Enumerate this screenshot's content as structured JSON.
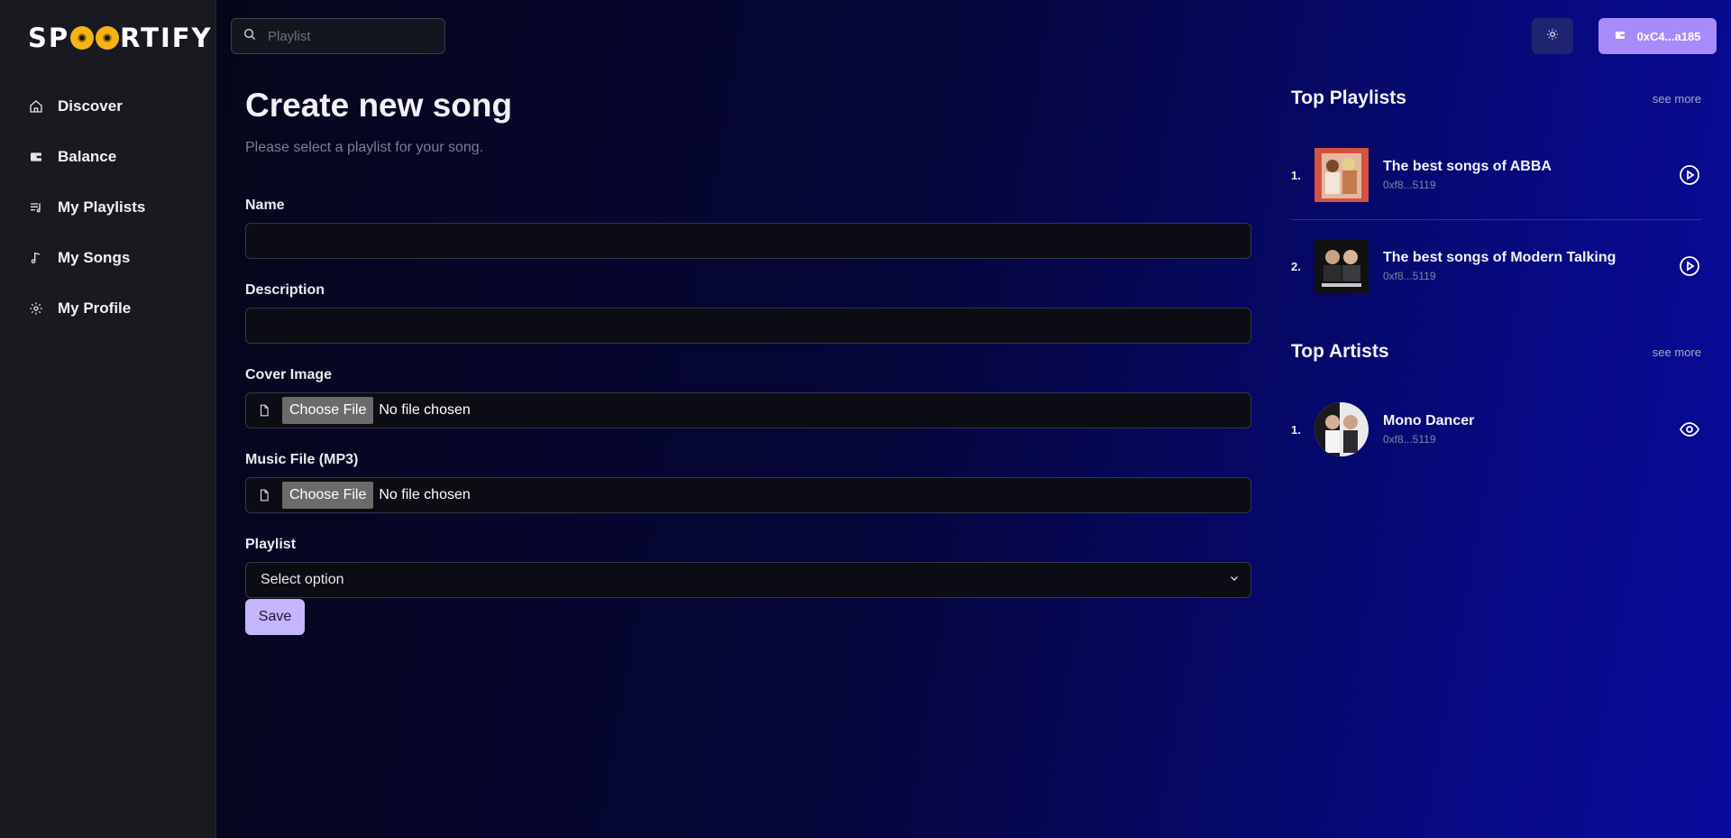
{
  "brand": {
    "name_part1": "SP",
    "name_part2": "RTIFY"
  },
  "sidebar": {
    "items": [
      {
        "label": "Discover",
        "icon": "home-icon"
      },
      {
        "label": "Balance",
        "icon": "wallet-icon"
      },
      {
        "label": "My Playlists",
        "icon": "playlist-icon"
      },
      {
        "label": "My Songs",
        "icon": "music-note-icon"
      },
      {
        "label": "My Profile",
        "icon": "gear-icon"
      }
    ]
  },
  "header": {
    "search_placeholder": "Playlist",
    "search_value": "",
    "wallet_label": "0xC4...a185"
  },
  "form": {
    "title": "Create new song",
    "subtitle": "Please select a playlist for your song.",
    "name_label": "Name",
    "name_value": "",
    "description_label": "Description",
    "description_value": "",
    "cover_label": "Cover Image",
    "music_label": "Music File (MP3)",
    "choose_file_label": "Choose File",
    "no_file_label": "No file chosen",
    "playlist_label": "Playlist",
    "playlist_selected": "Select option",
    "save_label": "Save"
  },
  "top_playlists": {
    "title": "Top Playlists",
    "see_more": "see more",
    "items": [
      {
        "rank": "1.",
        "name": "The best songs of ABBA",
        "address": "0xf8...5119"
      },
      {
        "rank": "2.",
        "name": "The best songs of Modern Talking",
        "address": "0xf8...5119"
      }
    ]
  },
  "top_artists": {
    "title": "Top Artists",
    "see_more": "see more",
    "items": [
      {
        "rank": "1.",
        "name": "Mono Dancer",
        "address": "0xf8...5119"
      }
    ]
  },
  "colors": {
    "accent": "#a78bfa",
    "save_button": "#c4b5fd",
    "sidebar_bg": "#181a20",
    "logo_disc": "#f5b415"
  }
}
